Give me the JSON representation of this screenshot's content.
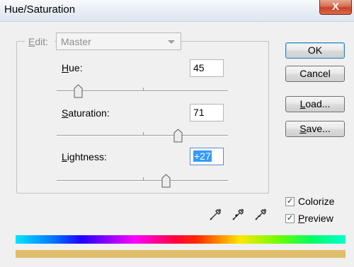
{
  "window": {
    "title": "Hue/Saturation",
    "close_label": "X"
  },
  "edit": {
    "label": "Edit:",
    "value": "Master"
  },
  "hue": {
    "label": "Hue:",
    "value": "45",
    "slider_fraction": 0.12
  },
  "saturation": {
    "label": "Saturation:",
    "value": "71",
    "slider_fraction": 0.71
  },
  "lightness": {
    "label": "Lightness:",
    "value": "+27",
    "slider_fraction": 0.635
  },
  "buttons": {
    "ok": "OK",
    "cancel": "Cancel",
    "load": "Load...",
    "save": "Save..."
  },
  "options": {
    "colorize": "Colorize",
    "preview": "Preview",
    "colorize_checked": true,
    "preview_checked": true
  },
  "colors": {
    "result_swatch": "#dfbd6a",
    "accent": "#3399ff"
  }
}
